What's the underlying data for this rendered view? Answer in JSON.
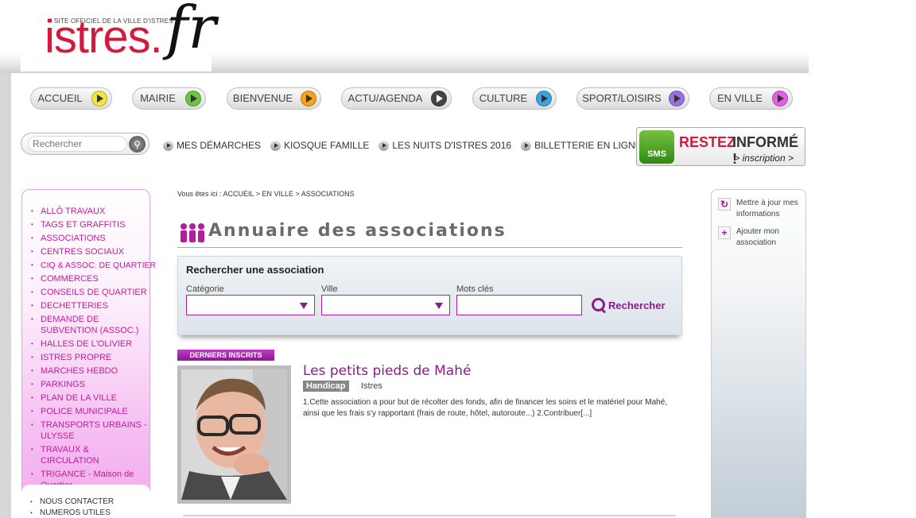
{
  "logo": {
    "small": "SITE OFFICIEL DE LA VILLE D'ISTRES",
    "main": "istres.",
    "fr": "fr"
  },
  "nav": [
    {
      "label": "ACCUEIL",
      "color": "#f2e63b"
    },
    {
      "label": "MAIRIE",
      "color": "#6cc440"
    },
    {
      "label": "BIENVENUE",
      "color": "#f6a21a"
    },
    {
      "label": "ACTU/AGENDA",
      "color": "#444444"
    },
    {
      "label": "CULTURE",
      "color": "#3aa3e0"
    },
    {
      "label": "SPORT/LOISIRS",
      "color": "#9a6fe0"
    },
    {
      "label": "EN VILLE",
      "color": "#e45fe8"
    }
  ],
  "search": {
    "placeholder": "Rechercher"
  },
  "quicklinks": [
    "MES DÉMARCHES",
    "KIOSQUE FAMILLE",
    "LES NUITS D'ISTRES 2016",
    "BILLETTERIE EN LIGNE"
  ],
  "sms": {
    "bubble": "SMS",
    "restez": "RESTEZ",
    "informe": "INFORMÉ !",
    "inscription": "> inscription >"
  },
  "sidebar": {
    "items": [
      "ALLÔ TRAVAUX",
      "TAGS ET GRAFFITIS",
      "ASSOCIATIONS",
      "CENTRES SOCIAUX",
      "CIQ & ASSOC. DE QUARTIER",
      "COMMERCES",
      "CONSEILS DE QUARTIER",
      "DECHETTERIES",
      "DEMANDE DE SUBVENTION (ASSOC.)",
      "HALLES DE L'OLIVIER",
      "ISTRES PROPRE",
      "MARCHES HEBDO",
      "PARKINGS",
      "PLAN DE LA VILLE",
      "POLICE MUNICIPALE",
      "TRANSPORTS URBAINS - ULYSSE",
      "TRAVAUX & CIRCULATION",
      "TRIGANCE - Maison de Quartier"
    ],
    "bottom_items": [
      "NOUS CONTACTER",
      "NUMEROS UTILES"
    ]
  },
  "breadcrumb": {
    "prefix": "Vous êtes ici :",
    "path": "ACCUEIL > EN VILLE >",
    "current": "ASSOCIATIONS"
  },
  "page_title": "Annuaire des associations",
  "search_panel": {
    "heading": "Rechercher une association",
    "categorie_label": "Catégorie",
    "ville_label": "Ville",
    "mots_cles_label": "Mots clés",
    "button_label": "Rechercher"
  },
  "latest": {
    "badge": "DERNIERS INSCRITS",
    "title": "Les petits pieds de Mahé",
    "category": "Handicap",
    "city": "Istres",
    "description": "1.Cette association a pour but de récolter des fonds, afin de financer les soins et le matériel pour Mahé, ainsi que les frais s'y rapportant (frais de route, hôtel, autoroute...) 2.Contribuer[...]"
  },
  "right_actions": [
    {
      "icon": "refresh-icon",
      "label": "Mettre à jour mes informations"
    },
    {
      "icon": "plus-icon",
      "label": "Ajouter mon association"
    }
  ],
  "colors": {
    "brand_red": "#d31a3c",
    "brand_purple": "#8c1b8f",
    "sidebar_pink": "#f3a9ee"
  }
}
